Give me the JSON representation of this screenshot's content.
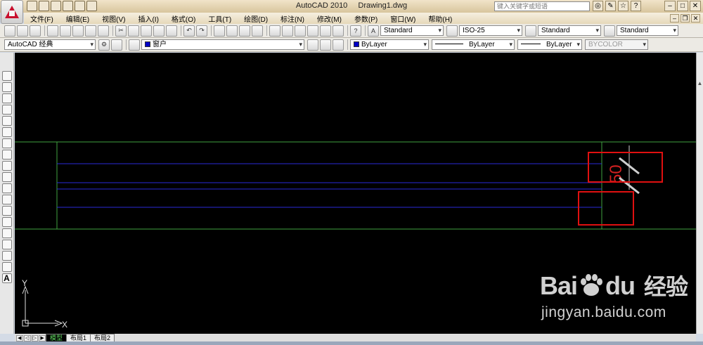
{
  "title_bar": {
    "app_name": "AutoCAD 2010",
    "document": "Drawing1.dwg",
    "search_placeholder": "键入关键字或短语"
  },
  "menu": {
    "items": [
      "文件(F)",
      "编辑(E)",
      "视图(V)",
      "插入(I)",
      "格式(O)",
      "工具(T)",
      "绘图(D)",
      "标注(N)",
      "修改(M)",
      "参数(P)",
      "窗口(W)",
      "帮助(H)"
    ]
  },
  "styles_toolbar": {
    "text_style": "Standard",
    "dim_style": "ISO-25",
    "table_style": "Standard",
    "multileader_style": "Standard"
  },
  "layers_toolbar": {
    "workspace": "AutoCAD 经典",
    "current_layer": "窗户",
    "layer_color": "#0000c8",
    "color": "ByLayer",
    "linetype": "ByLayer",
    "lineweight": "ByLayer",
    "plot_style": "BYCOLOR"
  },
  "drawing": {
    "dimension_text": "50",
    "dimension_text_color": "#d02020",
    "wall_line_color": "#3fa23f",
    "window_line_color": "#2a2ad8",
    "highlight_box_color": "#e01010",
    "ucs_x_label": "X",
    "ucs_y_label": "Y"
  },
  "layout_tabs": {
    "model": "模型",
    "layout1": "布局1",
    "layout2": "布局2"
  },
  "watermark": {
    "brand": "Bai",
    "brand_suffix": "du",
    "brand_cn": "经验",
    "url": "jingyan.baidu.com"
  }
}
